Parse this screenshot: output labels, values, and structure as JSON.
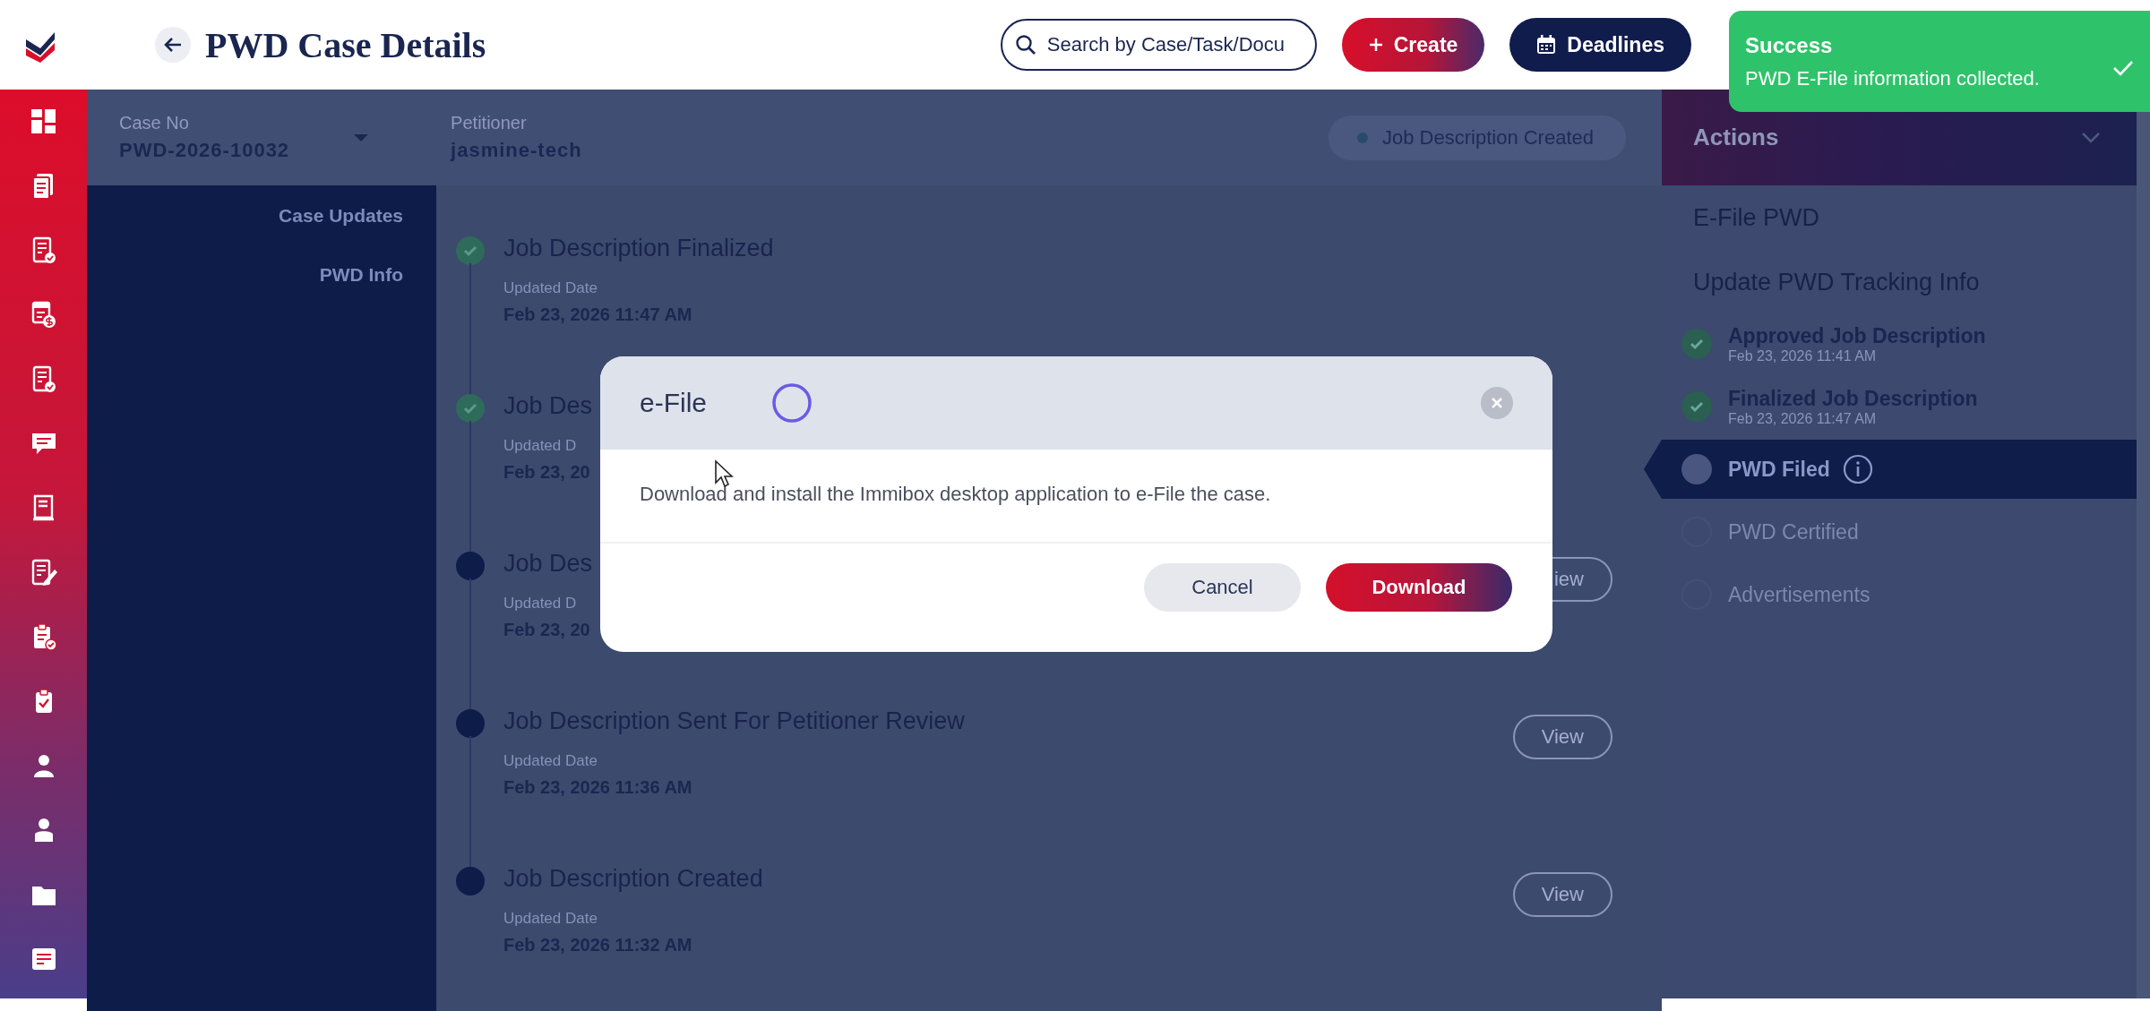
{
  "header": {
    "title": "PWD Case Details",
    "search": {
      "placeholder": "Search by Case/Task/Docu"
    },
    "buttons": [
      {
        "label": "Create",
        "kind": "create"
      },
      {
        "label": "Deadlines",
        "kind": "deadlines"
      }
    ]
  },
  "toast": {
    "title": "Success",
    "message": "PWD E-File information collected."
  },
  "case": {
    "case_no_label": "Case No",
    "case_no": "PWD-2026-10032",
    "petitioner_label": "Petitioner",
    "petitioner": "jasmine-tech",
    "status": "Job Description Created"
  },
  "nav": {
    "items": [
      {
        "label": "Case Updates",
        "selected": false
      },
      {
        "label": "PWD Info",
        "selected": false
      }
    ]
  },
  "timeline": [
    {
      "title": "Job Description Finalized",
      "date_label": "Updated Date",
      "date": "Feb 23, 2026 11:47 AM",
      "done": true
    },
    {
      "title": "Job Des",
      "date_label": "Updated D",
      "date": "Feb 23, 20",
      "done": true
    },
    {
      "title": "Job Des",
      "date_label": "Updated D",
      "date": "Feb 23, 20",
      "done": false,
      "view": "iew"
    },
    {
      "title": "Job Description Sent For Petitioner Review",
      "date_label": "Updated Date",
      "date": "Feb 23, 2026 11:36 AM",
      "done": false,
      "view": "View"
    },
    {
      "title": "Job Description Created",
      "date_label": "Updated Date",
      "date": "Feb 23, 2026 11:32 AM",
      "done": false,
      "view": "View"
    }
  ],
  "actions": {
    "title": "Actions",
    "items": [
      "E-File PWD",
      "Update PWD Tracking Info"
    ],
    "steps": [
      {
        "label": "Approved Job Description",
        "date": "Feb 23, 2026 11:41 AM",
        "done": true,
        "selected": false
      },
      {
        "label": "Finalized Job Description",
        "date": "Feb 23, 2026 11:47 AM",
        "done": true,
        "selected": false
      },
      {
        "label": "PWD Filed",
        "done": false,
        "selected": true,
        "info": true
      },
      {
        "label": "PWD Certified",
        "done": false,
        "selected": false
      },
      {
        "label": "Advertisements",
        "done": false,
        "selected": false
      }
    ]
  },
  "modal": {
    "title": "e-File",
    "message": "Download and install the Immibox desktop application to e-File the case.",
    "buttons": [
      {
        "label": "Cancel",
        "kind": "secondary"
      },
      {
        "label": "Download",
        "kind": "primary"
      }
    ]
  }
}
